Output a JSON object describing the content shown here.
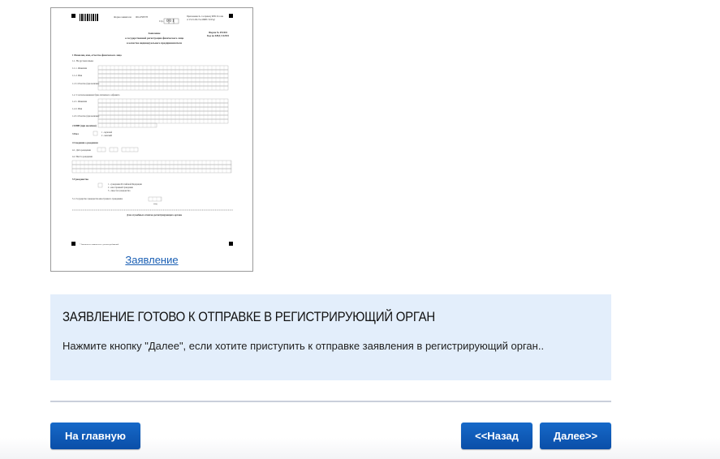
{
  "document": {
    "link_label": "Заявление",
    "header_left": "Форма заявителя",
    "code_number": "0014798778",
    "page_label": "Стр.",
    "page_number": "001",
    "header_right_1": "Приложение № 1 к приказу ФНС России",
    "header_right_2": "от 25.01.2012 № ММВ-7-6/25@",
    "form_number": "Форма № Р21001",
    "knd_code": "Код по КНД 1112501",
    "title_1": "Заявление",
    "title_2": "о государственной регистрации физического лица",
    "title_3": "в качестве индивидуального предпринимателя",
    "section_1": "1   Фамилия, имя, отчество физического лица",
    "section_1_1": "1.1. На русском языке",
    "row_surname": "1.1.1. Фамилия",
    "row_name": "1.1.2. Имя",
    "row_patronymic": "1.1.3. Отчество (при наличии)",
    "section_1_2": "1.2. С использованием букв латинского алфавита",
    "row_surname_lat": "1.2.1. Фамилия",
    "row_name_lat": "1.2.2. Имя",
    "row_patronymic_lat": "1.2.3. Отчество (при наличии)",
    "section_2": "2   ИНН (при наличии)",
    "section_3": "3   Пол",
    "gender_1": "1 - мужской",
    "gender_2": "2 - женский",
    "section_4": "4   Сведения о рождении",
    "birth_date": "4.1. Дата рождения",
    "birth_place": "4.2. Место рождения",
    "section_5": "5   Гражданство",
    "citizen_1": "1 - гражданин Российской Федерации",
    "citizen_2": "2 - иностранный гражданин",
    "citizen_3": "3 - лицо без гражданства",
    "section_5_1": "5.1. Государство гражданства иностранного гражданина",
    "country_code": "(код)",
    "official_use": "Для служебных отметок регистрирующего органа",
    "footnote": "* Заполняется заявителем с учетом требований"
  },
  "panel": {
    "title": "ЗАЯВЛЕНИЕ ГОТОВО К ОТПРАВКЕ В РЕГИСТРИРУЮЩИЙ ОРГАН",
    "text": "Нажмите кнопку \"Далее\", если хотите приступить к отправке заявления в регистрирующий орган.."
  },
  "buttons": {
    "home": "На главную",
    "back": "<<Назад",
    "next": "Далее>>"
  },
  "colors": {
    "button": "#0a4ea8",
    "panel_bg": "#e3eefb",
    "link": "#1a5fb4"
  }
}
